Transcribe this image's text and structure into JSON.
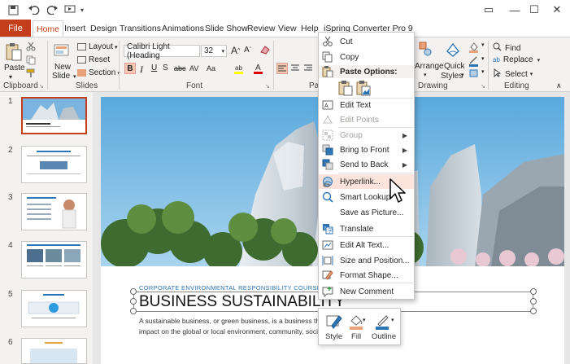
{
  "window": {
    "minimize_glyph": "—",
    "restore_glyph": "☐",
    "close_glyph": "✕",
    "ribbon_options_glyph": "▭",
    "collapse_glyph": "∧"
  },
  "ribbon_tabs": {
    "file": "File",
    "home": "Home",
    "insert": "Insert",
    "design": "Design",
    "transitions": "Transitions",
    "animations": "Animations",
    "slideshow": "Slide Show",
    "review": "Review",
    "view": "View",
    "help": "Help",
    "ispring": "iSpring Converter Pro 9"
  },
  "ribbon": {
    "clipboard": {
      "paste": "Paste",
      "label": "Clipboard"
    },
    "slides": {
      "new_slide_1": "New",
      "new_slide_2": "Slide",
      "layout": "Layout",
      "reset": "Reset",
      "section": "Section",
      "label": "Slides"
    },
    "font": {
      "font_name": "Calibri Light (Heading",
      "font_size": "32",
      "label": "Font"
    },
    "paragraph": {
      "label": "Par"
    },
    "drawing": {
      "arrange": "Arrange",
      "quick_styles_1": "Quick",
      "quick_styles_2": "Styles",
      "label": "Drawing"
    },
    "editing": {
      "find": "Find",
      "replace": "Replace",
      "select": "Select",
      "label": "Editing"
    }
  },
  "thumbnails": {
    "n1": "1",
    "n2": "2",
    "n3": "3",
    "n4": "4",
    "n5": "5",
    "n6": "6"
  },
  "slide": {
    "subtitle": "CORPORATE ENVIRONMENTAL RESPONSIBILITY COURSE",
    "title": "BUSINESS SUSTAINABILITY",
    "body_line1": "A sustainable business, or green business, is a business that h",
    "body_line2": "impact on the global or local environment, community, socie"
  },
  "context_menu": {
    "cut": "Cut",
    "copy": "Copy",
    "paste_options": "Paste Options:",
    "edit_text": "Edit Text",
    "edit_points": "Edit Points",
    "group": "Group",
    "bring_to_front": "Bring to Front",
    "send_to_back": "Send to Back",
    "hyperlink": "Hyperlink...",
    "smart_lookup": "Smart Lookup",
    "save_as_picture": "Save as Picture...",
    "translate": "Translate",
    "edit_alt_text": "Edit Alt Text...",
    "size_and_position": "Size and Position...",
    "format_shape": "Format Shape...",
    "new_comment": "New Comment"
  },
  "mini_toolbar": {
    "style": "Style",
    "fill": "Fill",
    "outline": "Outline"
  },
  "colors": {
    "accent": "#c43e1c",
    "highlight": "#fce4dc",
    "subtitle_blue": "#2e75b6"
  }
}
